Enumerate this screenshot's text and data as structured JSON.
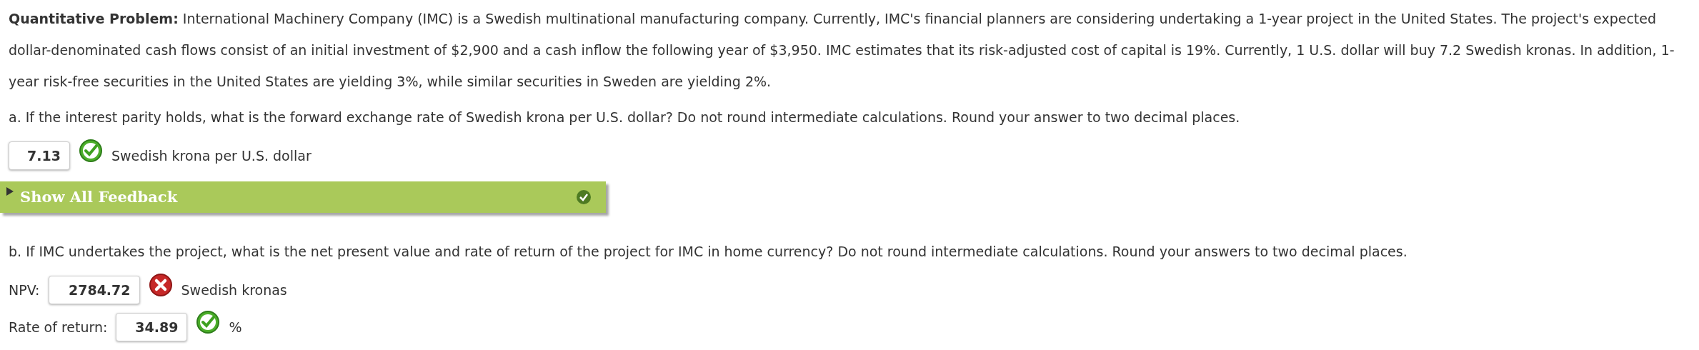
{
  "problem": {
    "label": "Quantitative Problem:",
    "text": "International Machinery Company (IMC) is a Swedish multinational manufacturing company. Currently, IMC's financial planners are considering undertaking a 1-year project in the United States. The project's expected dollar-denominated cash flows consist of an initial investment of $2,900 and a cash inflow the following year of $3,950. IMC estimates that its risk-adjusted cost of capital is 19%. Currently, 1 U.S. dollar will buy 7.2 Swedish kronas. In addition, 1-year risk-free securities in the United States are yielding 3%, while similar securities in Sweden are yielding 2%."
  },
  "parts": [
    {
      "question": "a. If the interest parity holds, what is the forward exchange rate of Swedish krona per U.S. dollar? Do not round intermediate calculations. Round your answer to two decimal places.",
      "answers": [
        {
          "value": "7.13",
          "correct": true,
          "unit": "Swedish krona per U.S. dollar"
        }
      ],
      "feedback": {
        "label": "Show All Feedback",
        "expanded": false,
        "correct": true
      }
    },
    {
      "question": "b. If IMC undertakes the project, what is the net present value and rate of return of the project for IMC in home currency? Do not round intermediate calculations. Round your answers to two decimal places.",
      "answers": [
        {
          "label": "NPV:",
          "value": "2784.72",
          "correct": false,
          "unit": "Swedish kronas"
        },
        {
          "label": "Rate of return:",
          "value": "34.89",
          "correct": true,
          "unit": "%"
        }
      ]
    }
  ]
}
